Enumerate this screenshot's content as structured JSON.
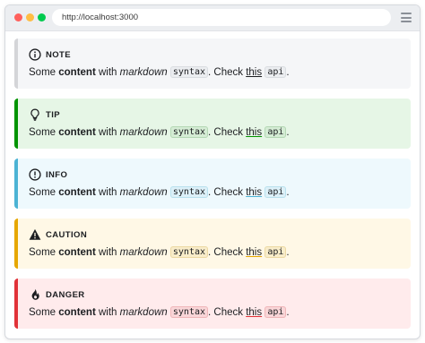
{
  "browser": {
    "url": "http://localhost:3000"
  },
  "admonitions": [
    {
      "type": "note",
      "title": "NOTE",
      "icon": "info-circle-icon",
      "text_some": "Some ",
      "text_bold": "content",
      "text_with": " with ",
      "text_italic": "markdown",
      "text_space": " ",
      "code_syntax": "syntax",
      "text_check": ". Check ",
      "link_this": "this",
      "code_api": "api",
      "text_end": ".",
      "accent_color": "#d4d5d8",
      "background_color": "#f5f6f8"
    },
    {
      "type": "tip",
      "title": "TIP",
      "icon": "lightbulb-icon",
      "text_some": "Some ",
      "text_bold": "content",
      "text_with": " with ",
      "text_italic": "markdown",
      "text_space": " ",
      "code_syntax": "syntax",
      "text_check": ". Check ",
      "link_this": "this",
      "code_api": "api",
      "text_end": ".",
      "accent_color": "#009400",
      "background_color": "#e6f6e6"
    },
    {
      "type": "info",
      "title": "INFO",
      "icon": "exclamation-circle-icon",
      "text_some": "Some ",
      "text_bold": "content",
      "text_with": " with ",
      "text_italic": "markdown",
      "text_space": " ",
      "code_syntax": "syntax",
      "text_check": ". Check ",
      "link_this": "this",
      "code_api": "api",
      "text_end": ".",
      "accent_color": "#4cb3d4",
      "background_color": "#eef9fd"
    },
    {
      "type": "caution",
      "title": "CAUTION",
      "icon": "warning-triangle-icon",
      "text_some": "Some ",
      "text_bold": "content",
      "text_with": " with ",
      "text_italic": "markdown",
      "text_space": " ",
      "code_syntax": "syntax",
      "text_check": ". Check ",
      "link_this": "this",
      "code_api": "api",
      "text_end": ".",
      "accent_color": "#e6a700",
      "background_color": "#fff8e6"
    },
    {
      "type": "danger",
      "title": "DANGER",
      "icon": "flame-icon",
      "text_some": "Some ",
      "text_bold": "content",
      "text_with": " with ",
      "text_italic": "markdown",
      "text_space": " ",
      "code_syntax": "syntax",
      "text_check": ". Check ",
      "link_this": "this",
      "code_api": "api",
      "text_end": ".",
      "accent_color": "#e13238",
      "background_color": "#ffebec"
    }
  ]
}
